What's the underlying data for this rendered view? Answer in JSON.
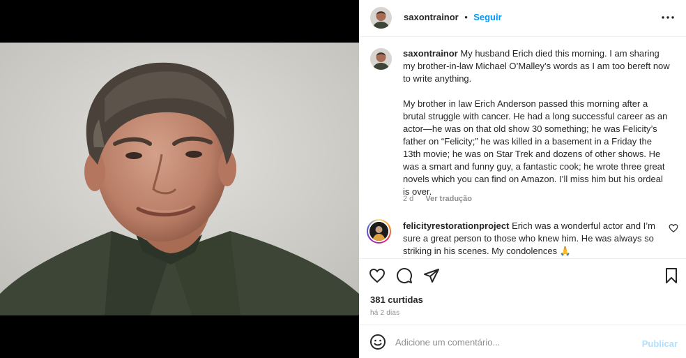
{
  "post": {
    "username": "saxontrainor",
    "dot": "•",
    "follow_label": "Seguir",
    "caption": "My husband Erich died this morning. I am sharing my brother-in-law Michael O’Malley’s words as I am too bereft now to write anything.\n\nMy brother in law Erich Anderson passed this morning after a brutal struggle with cancer. He had a long successful career as an actor—he was on that old show 30 something; he was Felicity’s father on “Felicity;” he was killed in a basement in a Friday the 13th movie; he was on Star Trek and dozens of other shows. He was a smart and funny guy, a fantastic cook; he wrote three great novels which you can find on Amazon. I’ll miss him but his ordeal is over.",
    "caption_age": "2 d",
    "translate_label": "Ver tradução"
  },
  "comment": {
    "username": "felicityrestorationproject",
    "text": "Erich was a wonderful actor and I’m sure a great person to those who knew him. He was always so striking in his scenes. My condolences 🙏"
  },
  "engagement": {
    "likes": "381 curtidas",
    "posted_ago": "há 2 dias"
  },
  "composer": {
    "placeholder": "Adicione um comentário...",
    "publish_label": "Publicar"
  },
  "icons": [
    "more-options-icon",
    "heart-icon",
    "comment-icon",
    "share-icon",
    "bookmark-icon",
    "emoji-icon",
    "like-comment-icon"
  ],
  "colors": {
    "link_blue": "#0095f6",
    "publish_disabled": "#b2dffc",
    "muted_text": "#8e8e8e"
  }
}
